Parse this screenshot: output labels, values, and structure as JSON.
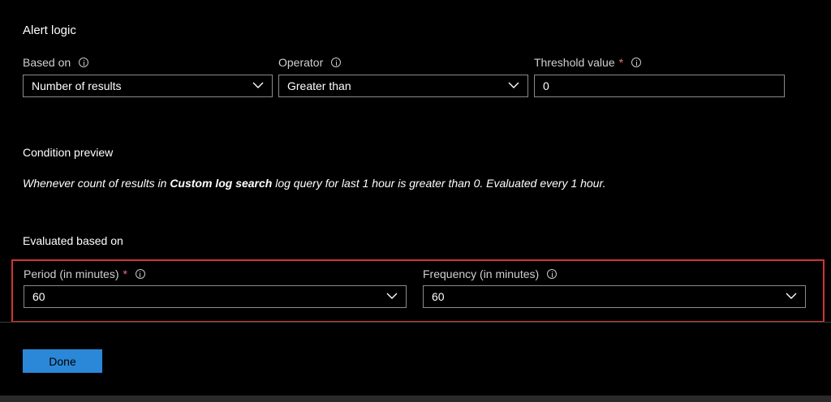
{
  "alert_logic": {
    "title": "Alert logic",
    "based_on": {
      "label": "Based on",
      "value": "Number of results"
    },
    "operator": {
      "label": "Operator",
      "value": "Greater than"
    },
    "threshold": {
      "label": "Threshold value",
      "required_mark": "*",
      "value": "0"
    }
  },
  "condition_preview": {
    "title": "Condition preview",
    "text_before": "Whenever count of results in ",
    "text_bold": "Custom log search",
    "text_after": " log query for last 1 hour is greater than 0. Evaluated every 1 hour."
  },
  "evaluated": {
    "title": "Evaluated based on",
    "period": {
      "label": "Period (in minutes)",
      "required_mark": "*",
      "value": "60"
    },
    "frequency": {
      "label": "Frequency (in minutes)",
      "value": "60"
    }
  },
  "footer": {
    "done_label": "Done"
  },
  "colors": {
    "background": "#000000",
    "highlight_border": "#d13438",
    "primary_button": "#2b88d8",
    "required": "#f1707b"
  },
  "icons": [
    "info-icon",
    "chevron-down-icon"
  ]
}
